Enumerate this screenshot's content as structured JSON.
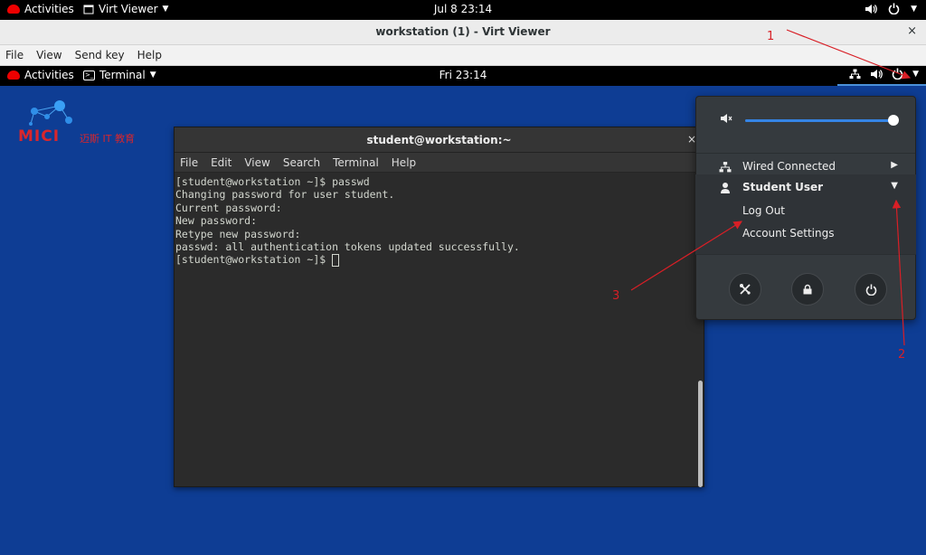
{
  "host_bar": {
    "activities": "Activities",
    "app": "Virt Viewer",
    "clock": "Jul 8  23:14"
  },
  "viewer": {
    "title": "workstation (1) - Virt Viewer",
    "close": "×",
    "menu": [
      "File",
      "View",
      "Send key",
      "Help"
    ]
  },
  "guest_bar": {
    "activities": "Activities",
    "app": "Terminal",
    "clock": "Fri 23:14"
  },
  "logo": {
    "text": "MICI",
    "subtext": "迈斯 IT 教育"
  },
  "terminal": {
    "title": "student@workstation:~",
    "close": "×",
    "menu": [
      "File",
      "Edit",
      "View",
      "Search",
      "Terminal",
      "Help"
    ],
    "lines": [
      "[student@workstation ~]$ passwd",
      "Changing password for user student.",
      "Current password:",
      "New password:",
      "Retype new password:",
      "passwd: all authentication tokens updated successfully."
    ],
    "prompt": "[student@workstation ~]$ "
  },
  "system_menu": {
    "volume_level": 0.96,
    "wired": "Wired Connected",
    "user": "Student User",
    "log_out": "Log Out",
    "account_settings": "Account Settings"
  },
  "annotations": [
    "1",
    "2",
    "3"
  ],
  "colors": {
    "desktop": "#0e3d94",
    "accent": "#3584e4",
    "annotation": "#d81f26"
  }
}
